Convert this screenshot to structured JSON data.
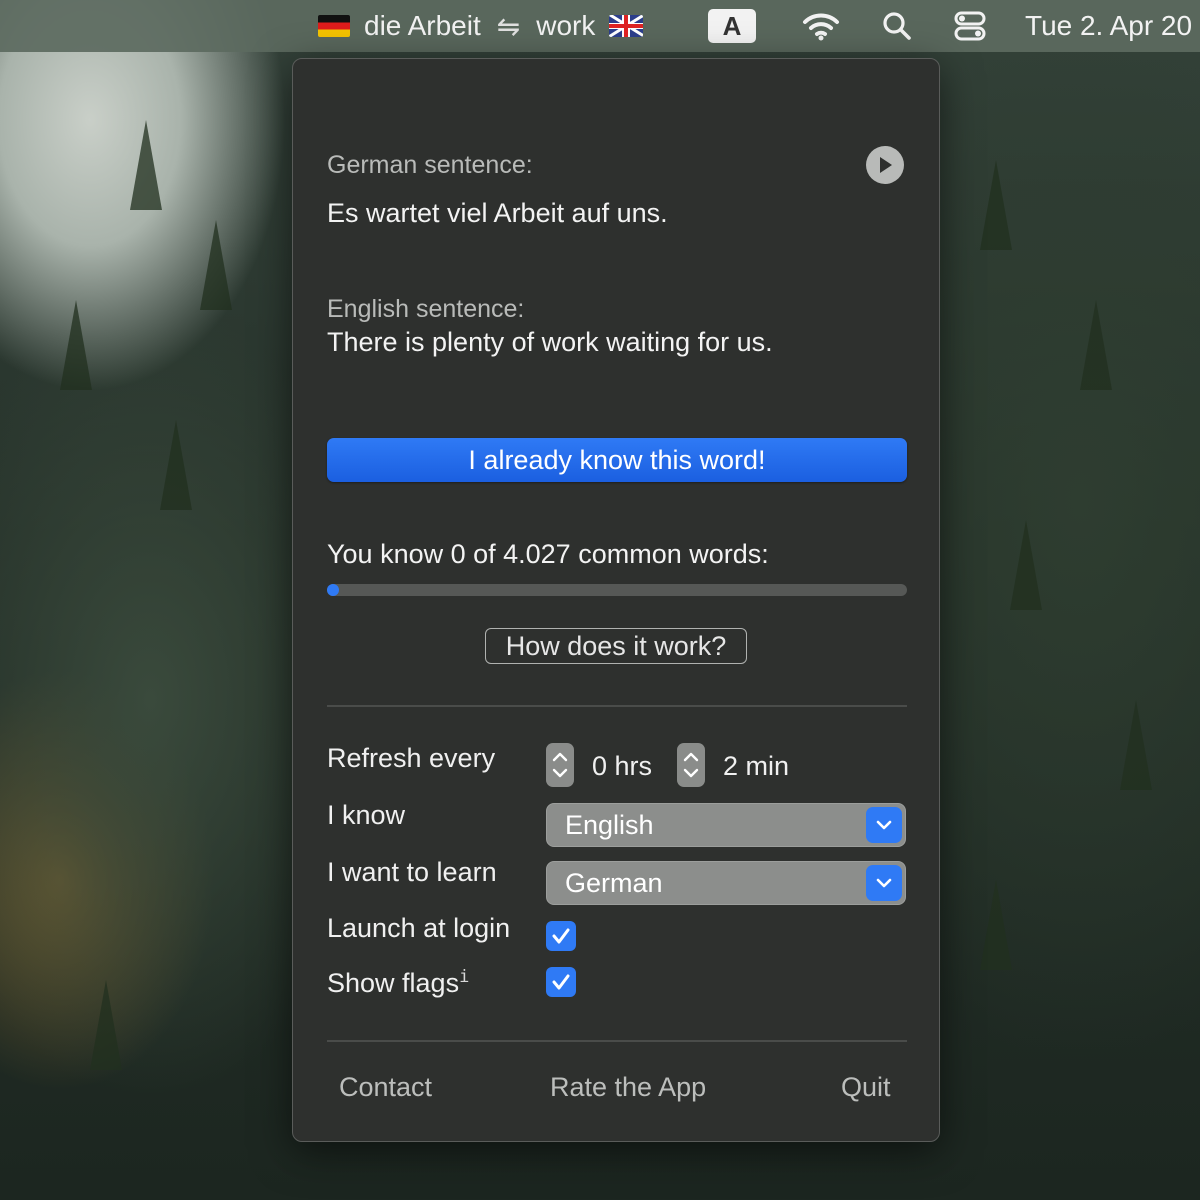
{
  "menubar": {
    "word_de": "die Arbeit",
    "swap_symbol": "⇋",
    "word_en": "work",
    "input_source": "A",
    "datetime": "Tue 2. Apr 20",
    "icons": [
      "germany-flag-icon",
      "uk-flag-icon",
      "wifi-icon",
      "search-icon",
      "control-center-icon"
    ]
  },
  "panel": {
    "german_label": "German sentence:",
    "german_sentence": "Es wartet viel Arbeit auf uns.",
    "english_label": "English sentence:",
    "english_sentence": "There is plenty of work waiting for us.",
    "know_button": "I already know this word!",
    "progress_text": "You know 0 of 4.027 common words:",
    "progress_fraction": 0,
    "how_button": "How does it work?",
    "settings": {
      "refresh_label": "Refresh every",
      "hours_value": "0 hrs",
      "minutes_value": "2 min",
      "know_label": "I know",
      "know_value": "English",
      "learn_label": "I want to learn",
      "learn_value": "German",
      "launch_label": "Launch at login",
      "launch_checked": true,
      "flags_label": "Show flags",
      "flags_info": "i",
      "flags_checked": true
    },
    "footer": {
      "contact": "Contact",
      "rate": "Rate the App",
      "quit": "Quit"
    }
  },
  "colors": {
    "accent": "#2f7af5",
    "panel_bg": "#2e302e"
  }
}
